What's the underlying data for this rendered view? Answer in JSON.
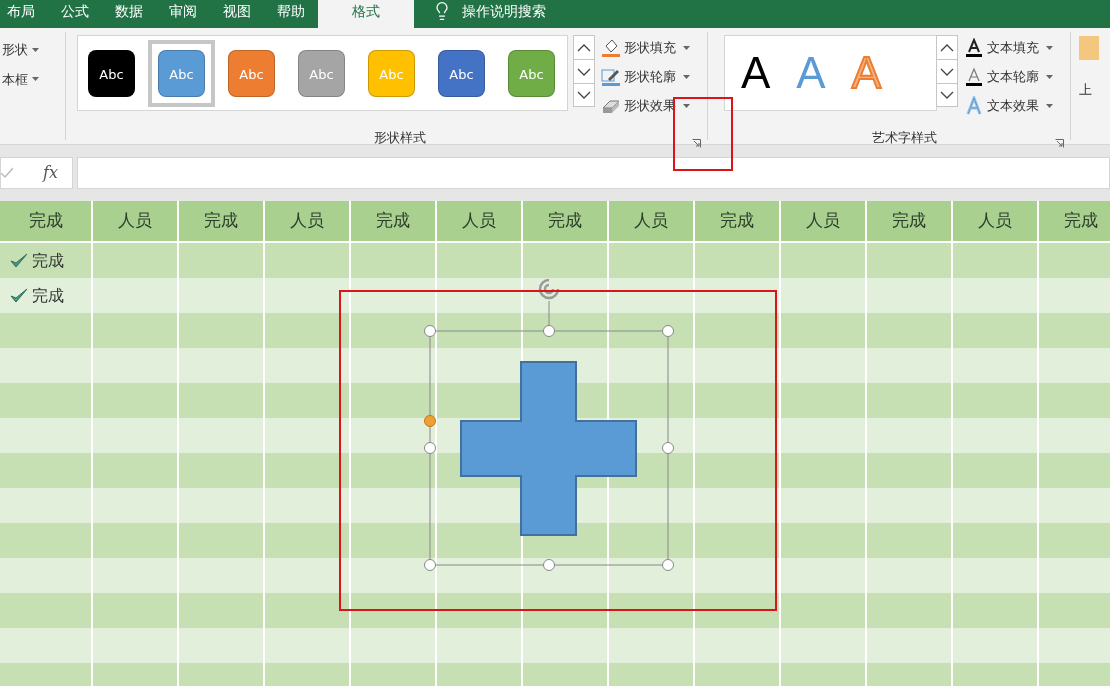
{
  "tabs": [
    {
      "label": "布局",
      "selected": false
    },
    {
      "label": "公式",
      "selected": false
    },
    {
      "label": "数据",
      "selected": false
    },
    {
      "label": "审阅",
      "selected": false
    },
    {
      "label": "视图",
      "selected": false
    },
    {
      "label": "帮助",
      "selected": false
    },
    {
      "label": "格式",
      "selected": true
    }
  ],
  "search": {
    "label": "操作说明搜索"
  },
  "left_group": {
    "items": [
      "形状",
      "本框"
    ]
  },
  "shape_styles": {
    "label": "形状样式",
    "styles": [
      {
        "text": "Abc",
        "color": "#000000",
        "selected": false
      },
      {
        "text": "Abc",
        "color": "#5b9bd5",
        "selected": true
      },
      {
        "text": "Abc",
        "color": "#ed7d31",
        "selected": false
      },
      {
        "text": "Abc",
        "color": "#a5a5a5",
        "selected": false
      },
      {
        "text": "Abc",
        "color": "#ffc000",
        "selected": false
      },
      {
        "text": "Abc",
        "color": "#4472c4",
        "selected": false
      },
      {
        "text": "Abc",
        "color": "#70ad47",
        "selected": false
      }
    ],
    "buttons": [
      {
        "kind": "fill",
        "label": "形状填充"
      },
      {
        "kind": "outline",
        "label": "形状轮廓"
      },
      {
        "kind": "effect",
        "label": "形状效果"
      }
    ]
  },
  "wordart_styles": {
    "label": "艺术字样式",
    "styles": [
      {
        "kind": "black",
        "text": "A"
      },
      {
        "kind": "blue",
        "text": "A"
      },
      {
        "kind": "orange",
        "text": "A"
      }
    ],
    "buttons": [
      {
        "kind": "fill",
        "label": "文本填充"
      },
      {
        "kind": "outline",
        "label": "文本轮廓"
      },
      {
        "kind": "effect",
        "label": "文本效果"
      }
    ]
  },
  "arrange": {
    "label": "上"
  },
  "formula_bar": {
    "fx": "fx"
  },
  "grid": {
    "headers": [
      "完成",
      "人员",
      "完成",
      "人员",
      "完成",
      "人员",
      "完成",
      "人员",
      "完成",
      "人员",
      "完成",
      "人员",
      "完成"
    ],
    "rows": [
      {
        "cells": [
          {
            "text": "完成",
            "checked": true
          }
        ]
      },
      {
        "cells": [
          {
            "text": "完成",
            "checked": true
          }
        ]
      },
      {
        "cells": []
      },
      {
        "cells": []
      },
      {
        "cells": []
      },
      {
        "cells": []
      },
      {
        "cells": []
      },
      {
        "cells": []
      },
      {
        "cells": []
      },
      {
        "cells": []
      },
      {
        "cells": []
      },
      {
        "cells": []
      },
      {
        "cells": []
      }
    ]
  },
  "shape": {
    "kind": "cross",
    "selected": true
  }
}
